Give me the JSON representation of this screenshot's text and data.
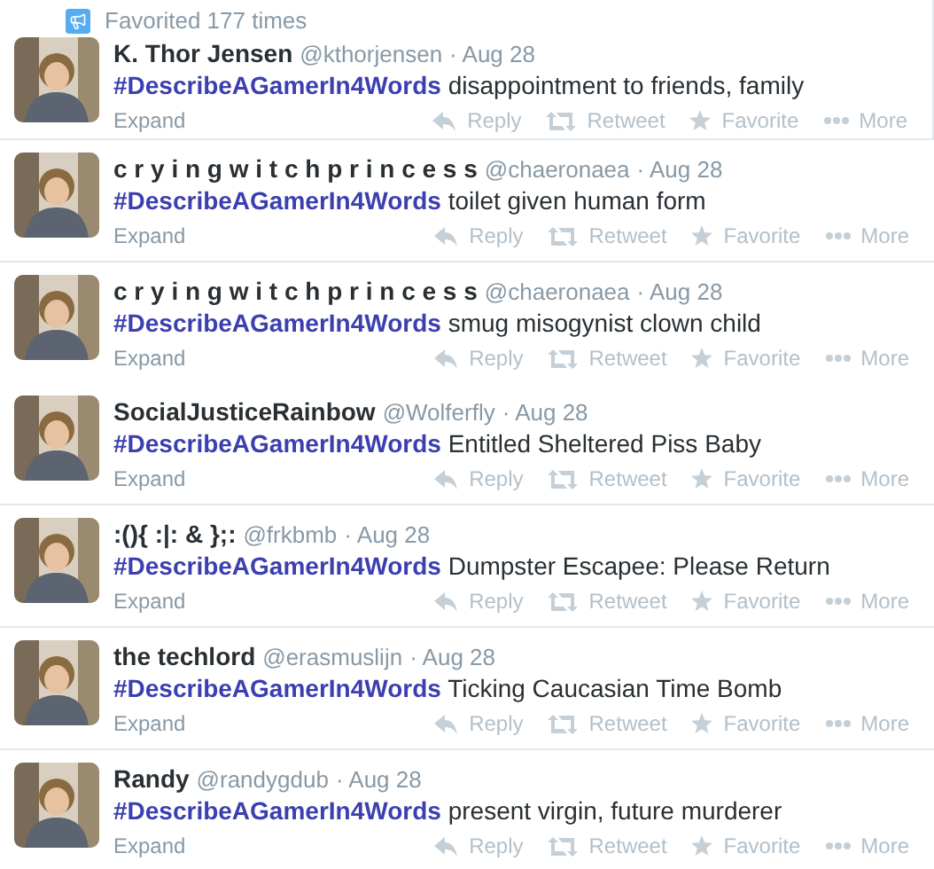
{
  "groups": [
    {
      "tweets": [
        {
          "context": "Favorited 177 times",
          "name": "K. Thor Jensen",
          "handle": "@kthorjensen",
          "time": "· Aug 28",
          "hashtag": "#DescribeAGamerIn4Words",
          "text": "disappointment to friends, family",
          "expand": "Expand",
          "actions": [
            "Reply",
            "Retweet",
            "Favorite",
            "More"
          ]
        }
      ]
    },
    {
      "tweets": [
        {
          "name": "c r y i n g w i t c h p r i n c e s s",
          "handle": "@chaeronaea",
          "time": "· Aug 28",
          "hashtag": "#DescribeAGamerIn4Words",
          "text": "toilet given human form",
          "expand": "Expand",
          "actions": [
            "Reply",
            "Retweet",
            "Favorite",
            "More"
          ]
        }
      ]
    },
    {
      "tweets": [
        {
          "name": "c r y i n g w i t c h p r i n c e s s",
          "handle": "@chaeronaea",
          "time": "· Aug 28",
          "hashtag": "#DescribeAGamerIn4Words",
          "text": "smug misogynist clown child",
          "expand": "Expand",
          "actions": [
            "Reply",
            "Retweet",
            "Favorite",
            "More"
          ]
        },
        {
          "name": "SocialJusticeRainbow",
          "handle": "@Wolferfly",
          "time": "· Aug 28",
          "hashtag": "#DescribeAGamerIn4Words",
          "text": "Entitled Sheltered Piss Baby",
          "expand": "Expand",
          "actions": [
            "Reply",
            "Retweet",
            "Favorite",
            "More"
          ]
        }
      ]
    },
    {
      "tweets": [
        {
          "name": ":(){ :|: & };:",
          "handle": "@frkbmb",
          "time": "· Aug 28",
          "hashtag": "#DescribeAGamerIn4Words",
          "text": "Dumpster Escapee: Please Return",
          "expand": "Expand",
          "actions": [
            "Reply",
            "Retweet",
            "Favorite",
            "More"
          ]
        }
      ]
    },
    {
      "tweets": [
        {
          "name": "the techlord",
          "handle": "@erasmuslijn",
          "time": "· Aug 28",
          "hashtag": "#DescribeAGamerIn4Words",
          "text": "Ticking Caucasian Time Bomb",
          "expand": "Expand",
          "actions": [
            "Reply",
            "Retweet",
            "Favorite",
            "More"
          ]
        }
      ]
    },
    {
      "tweets": [
        {
          "name": "Randy",
          "handle": "@randygdub",
          "time": "· Aug 28",
          "hashtag": "#DescribeAGamerIn4Words",
          "text": "present virgin, future murderer",
          "expand": "Expand",
          "actions": [
            "Reply",
            "Retweet",
            "Favorite",
            "More"
          ]
        }
      ]
    }
  ]
}
